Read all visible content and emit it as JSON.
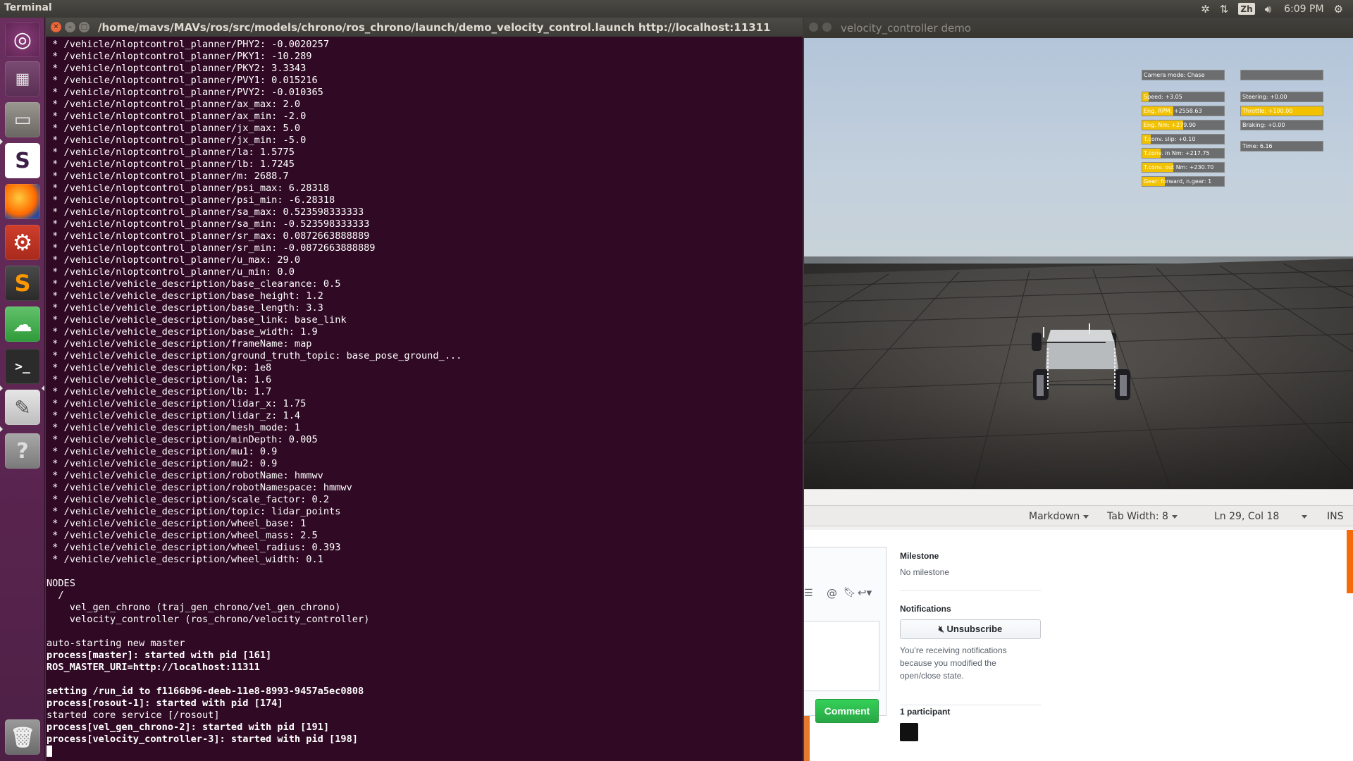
{
  "top_panel": {
    "app_title": "Terminal",
    "zh_label": "Zh",
    "clock": "6:09 PM"
  },
  "launcher": {
    "items": [
      {
        "name": "ubuntu-dash",
        "glyph": "◎"
      },
      {
        "name": "workspace-switcher",
        "glyph": "▦"
      },
      {
        "name": "files",
        "glyph": "▭"
      },
      {
        "name": "slack",
        "glyph": "S"
      },
      {
        "name": "firefox",
        "glyph": "◉"
      },
      {
        "name": "system-settings",
        "glyph": "⚙"
      },
      {
        "name": "sublime-text",
        "glyph": "S"
      },
      {
        "name": "wechat",
        "glyph": "☁"
      },
      {
        "name": "terminal",
        "glyph": ">_"
      },
      {
        "name": "text-editor",
        "glyph": "✎"
      },
      {
        "name": "help",
        "glyph": "?"
      },
      {
        "name": "trash",
        "glyph": "🗑"
      }
    ]
  },
  "terminal": {
    "title": "/home/mavs/MAVs/ros/src/models/chrono/ros_chrono/launch/demo_velocity_control.launch http://localhost:11311",
    "lines": [
      {
        "text": " * /vehicle/nloptcontrol_planner/PHY2: -0.0020257",
        "bold": false
      },
      {
        "text": " * /vehicle/nloptcontrol_planner/PKY1: -10.289",
        "bold": false
      },
      {
        "text": " * /vehicle/nloptcontrol_planner/PKY2: 3.3343",
        "bold": false
      },
      {
        "text": " * /vehicle/nloptcontrol_planner/PVY1: 0.015216",
        "bold": false
      },
      {
        "text": " * /vehicle/nloptcontrol_planner/PVY2: -0.010365",
        "bold": false
      },
      {
        "text": " * /vehicle/nloptcontrol_planner/ax_max: 2.0",
        "bold": false
      },
      {
        "text": " * /vehicle/nloptcontrol_planner/ax_min: -2.0",
        "bold": false
      },
      {
        "text": " * /vehicle/nloptcontrol_planner/jx_max: 5.0",
        "bold": false
      },
      {
        "text": " * /vehicle/nloptcontrol_planner/jx_min: -5.0",
        "bold": false
      },
      {
        "text": " * /vehicle/nloptcontrol_planner/la: 1.5775",
        "bold": false
      },
      {
        "text": " * /vehicle/nloptcontrol_planner/lb: 1.7245",
        "bold": false
      },
      {
        "text": " * /vehicle/nloptcontrol_planner/m: 2688.7",
        "bold": false
      },
      {
        "text": " * /vehicle/nloptcontrol_planner/psi_max: 6.28318",
        "bold": false
      },
      {
        "text": " * /vehicle/nloptcontrol_planner/psi_min: -6.28318",
        "bold": false
      },
      {
        "text": " * /vehicle/nloptcontrol_planner/sa_max: 0.523598333333",
        "bold": false
      },
      {
        "text": " * /vehicle/nloptcontrol_planner/sa_min: -0.523598333333",
        "bold": false
      },
      {
        "text": " * /vehicle/nloptcontrol_planner/sr_max: 0.0872663888889",
        "bold": false
      },
      {
        "text": " * /vehicle/nloptcontrol_planner/sr_min: -0.0872663888889",
        "bold": false
      },
      {
        "text": " * /vehicle/nloptcontrol_planner/u_max: 29.0",
        "bold": false
      },
      {
        "text": " * /vehicle/nloptcontrol_planner/u_min: 0.0",
        "bold": false
      },
      {
        "text": " * /vehicle/vehicle_description/base_clearance: 0.5",
        "bold": false
      },
      {
        "text": " * /vehicle/vehicle_description/base_height: 1.2",
        "bold": false
      },
      {
        "text": " * /vehicle/vehicle_description/base_length: 3.3",
        "bold": false
      },
      {
        "text": " * /vehicle/vehicle_description/base_link: base_link",
        "bold": false
      },
      {
        "text": " * /vehicle/vehicle_description/base_width: 1.9",
        "bold": false
      },
      {
        "text": " * /vehicle/vehicle_description/frameName: map",
        "bold": false
      },
      {
        "text": " * /vehicle/vehicle_description/ground_truth_topic: base_pose_ground_...",
        "bold": false
      },
      {
        "text": " * /vehicle/vehicle_description/kp: 1e8",
        "bold": false
      },
      {
        "text": " * /vehicle/vehicle_description/la: 1.6",
        "bold": false
      },
      {
        "text": " * /vehicle/vehicle_description/lb: 1.7",
        "bold": false
      },
      {
        "text": " * /vehicle/vehicle_description/lidar_x: 1.75",
        "bold": false
      },
      {
        "text": " * /vehicle/vehicle_description/lidar_z: 1.4",
        "bold": false
      },
      {
        "text": " * /vehicle/vehicle_description/mesh_mode: 1",
        "bold": false
      },
      {
        "text": " * /vehicle/vehicle_description/minDepth: 0.005",
        "bold": false
      },
      {
        "text": " * /vehicle/vehicle_description/mu1: 0.9",
        "bold": false
      },
      {
        "text": " * /vehicle/vehicle_description/mu2: 0.9",
        "bold": false
      },
      {
        "text": " * /vehicle/vehicle_description/robotName: hmmwv",
        "bold": false
      },
      {
        "text": " * /vehicle/vehicle_description/robotNamespace: hmmwv",
        "bold": false
      },
      {
        "text": " * /vehicle/vehicle_description/scale_factor: 0.2",
        "bold": false
      },
      {
        "text": " * /vehicle/vehicle_description/topic: lidar_points",
        "bold": false
      },
      {
        "text": " * /vehicle/vehicle_description/wheel_base: 1",
        "bold": false
      },
      {
        "text": " * /vehicle/vehicle_description/wheel_mass: 2.5",
        "bold": false
      },
      {
        "text": " * /vehicle/vehicle_description/wheel_radius: 0.393",
        "bold": false
      },
      {
        "text": " * /vehicle/vehicle_description/wheel_width: 0.1",
        "bold": false
      },
      {
        "text": "",
        "bold": false
      },
      {
        "text": "NODES",
        "bold": false
      },
      {
        "text": "  /",
        "bold": false
      },
      {
        "text": "    vel_gen_chrono (traj_gen_chrono/vel_gen_chrono)",
        "bold": false
      },
      {
        "text": "    velocity_controller (ros_chrono/velocity_controller)",
        "bold": false
      },
      {
        "text": "",
        "bold": false
      },
      {
        "text": "auto-starting new master",
        "bold": false
      },
      {
        "text": "process[master]: started with pid [161]",
        "bold": true
      },
      {
        "text": "ROS_MASTER_URI=http://localhost:11311",
        "bold": true
      },
      {
        "text": "",
        "bold": false
      },
      {
        "text": "setting /run_id to f1166b96-deeb-11e8-8993-9457a5ec0808",
        "bold": true
      },
      {
        "text": "process[rosout-1]: started with pid [174]",
        "bold": true
      },
      {
        "text": "started core service [/rosout]",
        "bold": false
      },
      {
        "text": "process[vel_gen_chrono-2]: started with pid [191]",
        "bold": true
      },
      {
        "text": "process[velocity_controller-3]: started with pid [198]",
        "bold": true
      }
    ]
  },
  "velocity_window": {
    "title": "velocity_controller demo",
    "hud_left": [
      {
        "label": "Camera mode: Chase",
        "fill": 0
      },
      {
        "label": "Speed: +3.05",
        "fill": 0.08
      },
      {
        "label": "Eng. RPM: +2558.63",
        "fill": 0.38
      },
      {
        "label": "Eng. Nm: +279.90",
        "fill": 0.5
      },
      {
        "label": "T.conv. slip: +0.10",
        "fill": 0.1
      },
      {
        "label": "T.conv. in  Nm: +217.75",
        "fill": 0.22
      },
      {
        "label": "T.conv. out Nm: +230.70",
        "fill": 0.38
      },
      {
        "label": "Gear: forward, n.gear: 1",
        "fill": 0.28
      }
    ],
    "hud_right": [
      {
        "label": "",
        "fill": 0
      },
      {
        "label": "Steering: +0.00",
        "fill": 0
      },
      {
        "label": "Throttle: +100.00",
        "fill": 1.0
      },
      {
        "label": "Braking: +0.00",
        "fill": 0
      },
      {
        "label": "Time: 6.16",
        "fill": 0
      }
    ],
    "hud_colors": {
      "fill": "#f2c200",
      "box": "#6c6d6e"
    }
  },
  "gedit_status": {
    "language": "Markdown",
    "tab_width": "Tab Width: 8",
    "position": "Ln 29, Col 18",
    "mode": "INS"
  },
  "github": {
    "milestone_heading": "Milestone",
    "milestone_value": "No milestone",
    "notifications_heading": "Notifications",
    "unsubscribe_label": "Unsubscribe",
    "notifications_text_1": "You’re receiving notifications",
    "notifications_text_2": "because you modified the",
    "notifications_text_3": "open/close state.",
    "participants_heading": "1 participant",
    "comment_button": "Comment",
    "toolbar_icons": [
      "mention-icon",
      "bookmark-icon",
      "reply-icon"
    ]
  }
}
